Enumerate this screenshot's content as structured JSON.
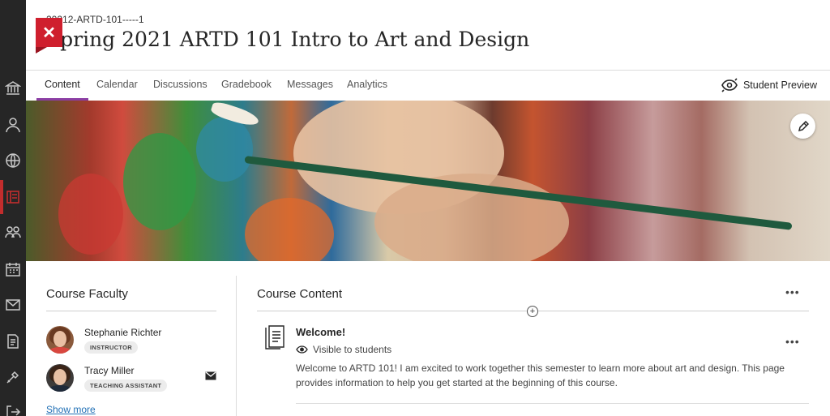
{
  "course": {
    "id": "20212-ARTD-101-----1",
    "title": "Spring 2021 ARTD 101 Intro to Art and Design"
  },
  "tabs": [
    {
      "label": "Content",
      "active": true
    },
    {
      "label": "Calendar"
    },
    {
      "label": "Discussions"
    },
    {
      "label": "Gradebook"
    },
    {
      "label": "Messages"
    },
    {
      "label": "Analytics"
    }
  ],
  "student_preview": {
    "label": "Student Preview",
    "icon": "student-preview-icon"
  },
  "rail_icons": [
    "institution-icon",
    "person-icon",
    "globe-icon",
    "courses-icon",
    "groups-icon",
    "calendar-icon",
    "messages-icon",
    "grades-icon",
    "tools-icon",
    "sign-out-icon"
  ],
  "faculty": {
    "title": "Course Faculty",
    "members": [
      {
        "name": "Stephanie Richter",
        "role": "INSTRUCTOR"
      },
      {
        "name": "Tracy Miller",
        "role": "TEACHING ASSISTANT"
      }
    ],
    "show_more": "Show more"
  },
  "content": {
    "title": "Course Content",
    "more": "•••",
    "items": [
      {
        "title": "Welcome!",
        "visibility": "Visible to students",
        "description": "Welcome to ARTD 101! I am excited to work together this semester to learn more about art and design. This page provides information to help you get started at the beginning of this course.",
        "more": "•••"
      }
    ]
  },
  "colors": {
    "accent": "#8b3ea4",
    "close": "#cf1f2e",
    "link": "#1f6fb5"
  }
}
